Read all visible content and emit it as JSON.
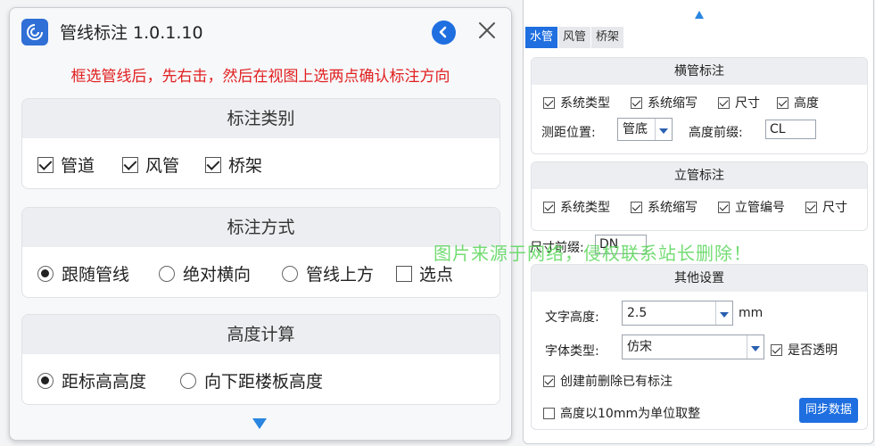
{
  "left": {
    "title": "管线标注 1.0.1.10",
    "hint": "框选管线后，先右击，然后在视图上选两点确认标注方向",
    "sections": [
      {
        "title": "标注类别",
        "options": [
          {
            "label": "管道",
            "checked": true
          },
          {
            "label": "风管",
            "checked": true
          },
          {
            "label": "桥架",
            "checked": true
          }
        ]
      },
      {
        "title": "标注方式",
        "options": [
          {
            "label": "跟随管线",
            "checked": true
          },
          {
            "label": "绝对横向",
            "checked": false
          },
          {
            "label": "管线上方",
            "checked": false
          },
          {
            "label": "选点",
            "checked": false
          }
        ]
      },
      {
        "title": "高度计算",
        "options": [
          {
            "label": "距标高高度",
            "checked": true
          },
          {
            "label": "向下距楼板高度",
            "checked": false
          }
        ]
      }
    ]
  },
  "right": {
    "tabs": [
      "水管",
      "风管",
      "桥架"
    ],
    "active_tab": "水管",
    "horizontal": {
      "title": "横管标注",
      "checks": [
        {
          "label": "系统类型",
          "checked": true
        },
        {
          "label": "系统缩写",
          "checked": true
        },
        {
          "label": "尺寸",
          "checked": true
        },
        {
          "label": "高度",
          "checked": true
        }
      ],
      "distance_label": "测距位置:",
      "distance_value": "管底",
      "height_prefix_label": "高度前缀:",
      "height_prefix_value": "CL"
    },
    "vertical": {
      "title": "立管标注",
      "checks": [
        {
          "label": "系统类型",
          "checked": true
        },
        {
          "label": "系统缩写",
          "checked": true
        },
        {
          "label": "立管编号",
          "checked": true
        },
        {
          "label": "尺寸",
          "checked": true
        }
      ]
    },
    "size_prefix_label": "尺寸前缀:",
    "size_prefix_value": "DN",
    "other": {
      "title": "其他设置",
      "text_height_label": "文字高度:",
      "text_height_value": "2.5",
      "text_height_unit": "mm",
      "font_type_label": "字体类型:",
      "font_type_value": "仿宋",
      "transparent_label": "是否透明",
      "transparent_checked": true,
      "delete_label": "创建前删除已有标注",
      "delete_checked": true,
      "round_label": "高度以10mm为单位取整",
      "round_checked": false,
      "sync_label": "同步数据"
    }
  },
  "watermark": "图片来源于网络，侵权联系站长删除！",
  "colors": {
    "accent": "#1f6fe0",
    "hint": "#e02020",
    "watermark": "#5bd75b"
  }
}
